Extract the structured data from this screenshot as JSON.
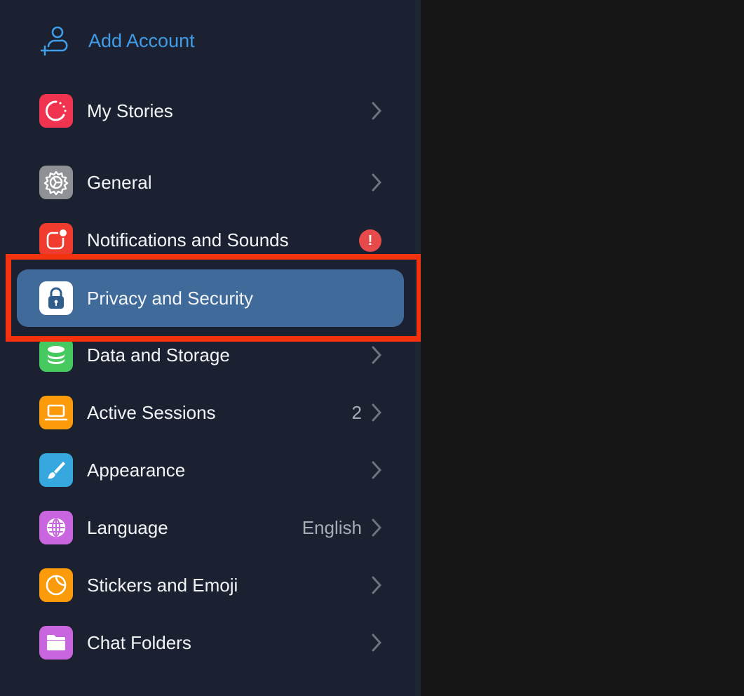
{
  "add_account": {
    "label": "Add Account",
    "icon": "add-user-icon",
    "color": "#3f9ce8"
  },
  "colors": {
    "sidebar_bg": "#1b2130",
    "selected_bg": "#3f6a99",
    "highlight_border": "#f3330f",
    "text": "#f2f4f7",
    "secondary_text": "#a8adb5",
    "alert": "#e64a4a"
  },
  "items": [
    {
      "label": "My Stories",
      "icon": "stories-icon",
      "icon_bg": "#f0344f",
      "value": "",
      "chevron": true
    },
    {
      "label": "General",
      "icon": "gear-icon",
      "icon_bg": "#8e9196",
      "value": "",
      "chevron": true
    },
    {
      "label": "Notifications and Sounds",
      "icon": "notification-icon",
      "icon_bg": "#f03c2e",
      "value": "",
      "badge": "!",
      "chevron": false
    },
    {
      "label": "Privacy and Security",
      "icon": "lock-icon",
      "icon_bg": "#ffffff",
      "value": "",
      "selected": true,
      "chevron": false
    },
    {
      "label": "Data and Storage",
      "icon": "database-icon",
      "icon_bg": "#46c95e",
      "value": "",
      "chevron": true
    },
    {
      "label": "Active Sessions",
      "icon": "laptop-icon",
      "icon_bg": "#fb9b0c",
      "value": "2",
      "chevron": true
    },
    {
      "label": "Appearance",
      "icon": "brush-icon",
      "icon_bg": "#36a8df",
      "value": "",
      "chevron": true
    },
    {
      "label": "Language",
      "icon": "globe-icon",
      "icon_bg": "#c966df",
      "value": "English",
      "chevron": true
    },
    {
      "label": "Stickers and Emoji",
      "icon": "sticker-icon",
      "icon_bg": "#fb9b0c",
      "value": "",
      "chevron": true
    },
    {
      "label": "Chat Folders",
      "icon": "folder-icon",
      "icon_bg": "#c966df",
      "value": "",
      "chevron": true
    }
  ]
}
